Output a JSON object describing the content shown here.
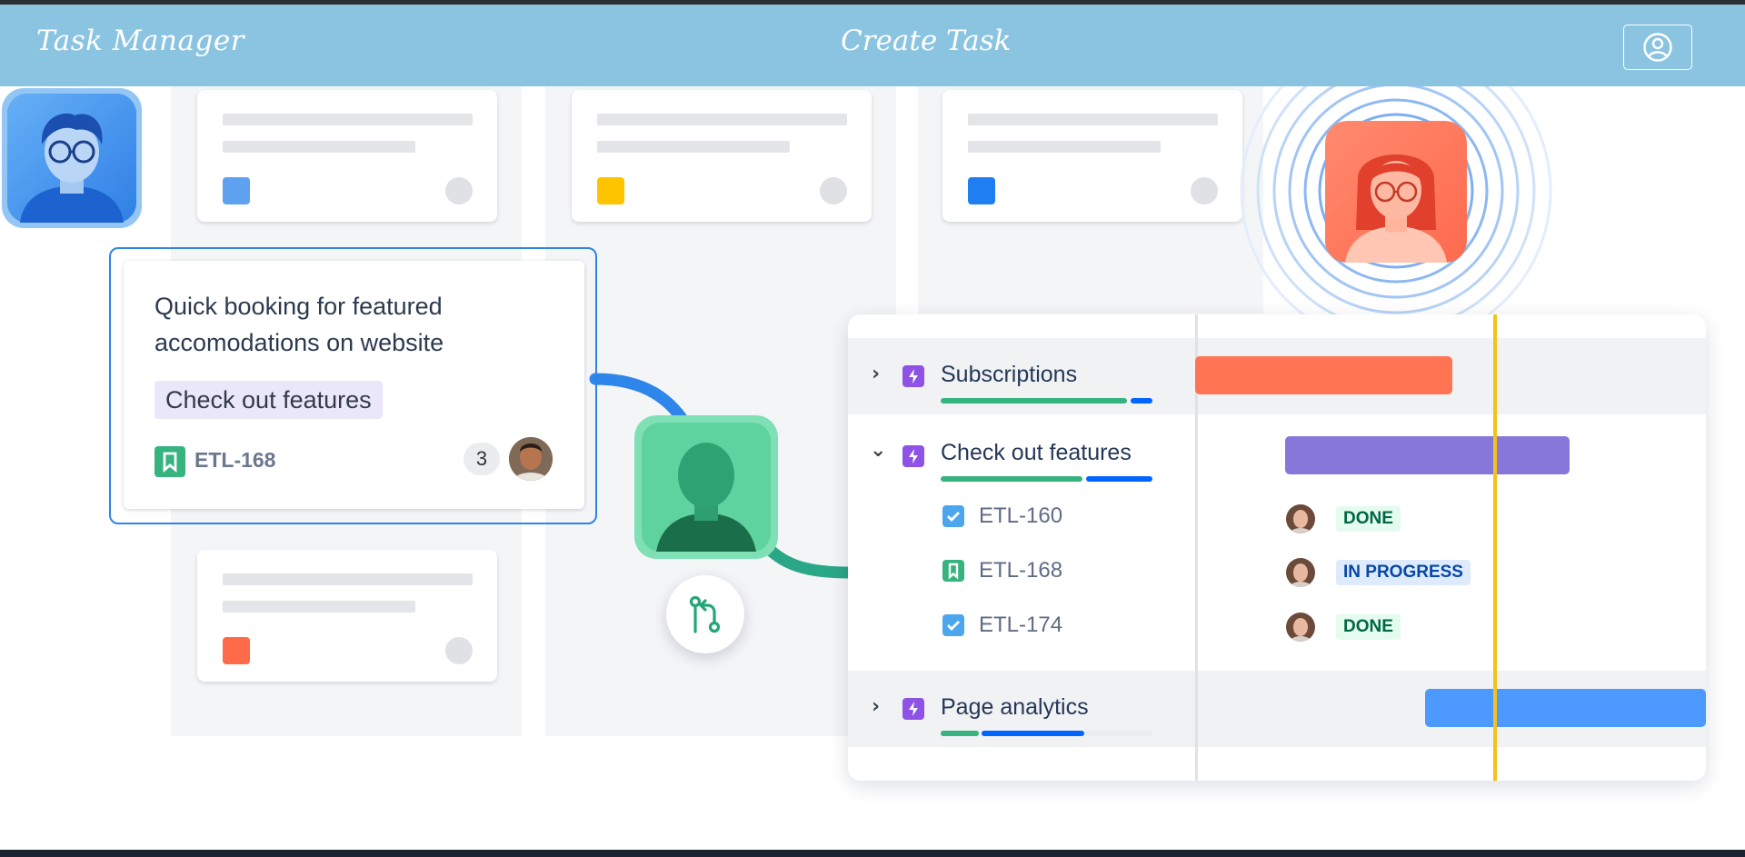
{
  "header": {
    "app_title": "Task Manager",
    "nav_link": "Create Task",
    "profile_icon": "user-circle-icon"
  },
  "colors": {
    "header_bg": "#8bc4e1",
    "selection_border": "#2f84e6",
    "today_line": "#f4c21b"
  },
  "board": {
    "skeleton_cards": [
      {
        "square_color": "#5ea1ef"
      },
      {
        "square_color": "#ffc400"
      },
      {
        "square_color": "#1f7ff0"
      },
      {
        "square_color": "#ff6b48"
      }
    ]
  },
  "feature_card": {
    "title": "Quick booking for featured accomodations on website",
    "tag": "Check out features",
    "key": "ETL-168",
    "key_icon": "bookmark-icon",
    "comment_count": "3"
  },
  "timeline": {
    "epics": [
      {
        "label": "Subscriptions",
        "expanded": false,
        "progress_done": 0.8,
        "progress_in_progress": 0.12,
        "bar_color": "#ff7452"
      },
      {
        "label": "Check out features",
        "expanded": true,
        "progress_done": 0.67,
        "progress_in_progress": 0.31,
        "bar_color": "#8777d9",
        "children": [
          {
            "key": "ETL-160",
            "icon": "checkbox-icon",
            "status": "DONE"
          },
          {
            "key": "ETL-168",
            "icon": "bookmark-icon",
            "status": "IN PROGRESS"
          },
          {
            "key": "ETL-174",
            "icon": "checkbox-icon",
            "status": "DONE"
          }
        ]
      },
      {
        "label": "Page analytics",
        "expanded": false,
        "progress_done": 0.18,
        "progress_in_progress": 0.49,
        "bar_color": "#4c9aff"
      }
    ]
  },
  "merge_action_icon": "git-pull-request-icon"
}
